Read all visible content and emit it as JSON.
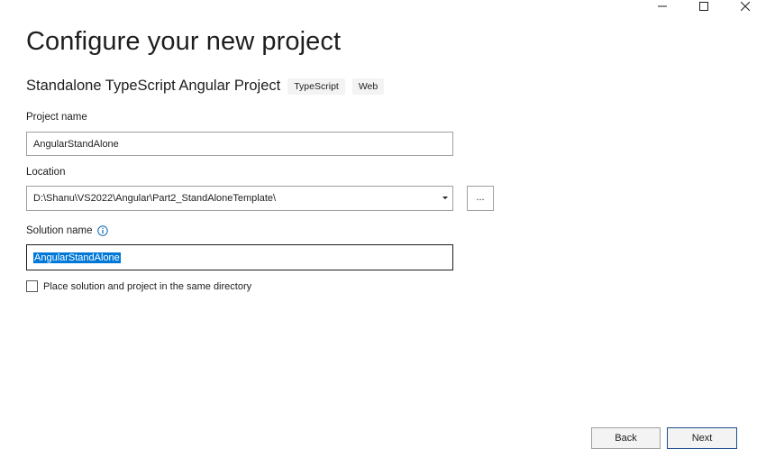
{
  "header": {
    "title": "Configure your new project"
  },
  "template": {
    "name": "Standalone TypeScript Angular Project",
    "tags": [
      "TypeScript",
      "Web"
    ]
  },
  "form": {
    "project_name": {
      "label": "Project name",
      "value": "AngularStandAlone"
    },
    "location": {
      "label": "Location",
      "value": "D:\\Shanu\\VS2022\\Angular\\Part2_StandAloneTemplate\\",
      "browse_label": "..."
    },
    "solution_name": {
      "label": "Solution name",
      "value": "AngularStandAlone"
    },
    "same_directory": {
      "label": "Place solution and project in the same directory",
      "checked": false
    }
  },
  "footer": {
    "back_label": "Back",
    "next_label": "Next"
  },
  "colors": {
    "selection": "#0078d7",
    "info_icon": "#0063b1"
  },
  "icons": {
    "minimize": "minimize-icon",
    "maximize": "maximize-icon",
    "close": "close-icon",
    "info": "info-icon",
    "dropdown": "chevron-down-icon"
  }
}
